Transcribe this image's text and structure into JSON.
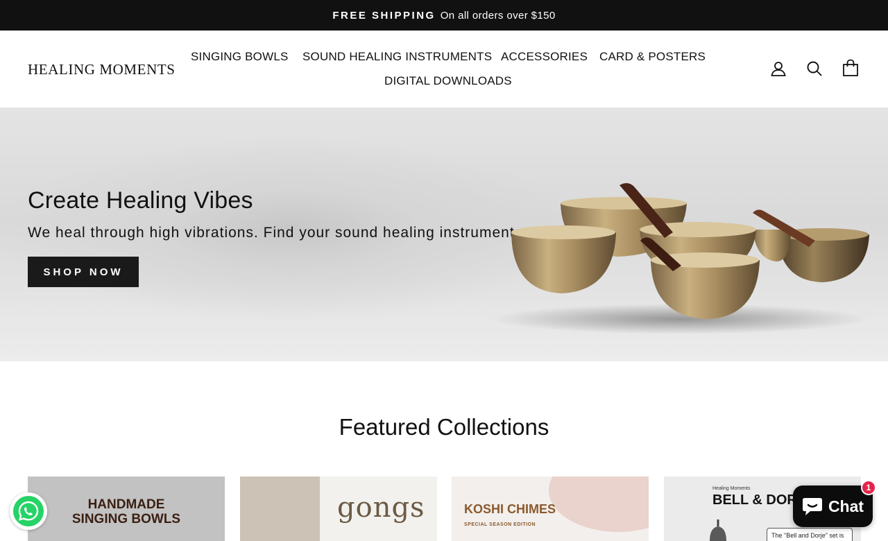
{
  "announcement": {
    "strong": "FREE SHIPPING",
    "text": "On all orders over $150"
  },
  "header": {
    "logo": "HEALING MOMENTS",
    "nav": [
      {
        "label": "SINGING BOWLS"
      },
      {
        "label": "SOUND HEALING INSTRUMENTS"
      },
      {
        "label": "ACCESSORIES"
      },
      {
        "label": "CARD & POSTERS"
      },
      {
        "label": "DIGITAL DOWNLOADS"
      }
    ],
    "icons": [
      "account-icon",
      "search-icon",
      "cart-icon"
    ]
  },
  "hero": {
    "title": "Create Healing Vibes",
    "subtitle": "We heal through high vibrations. Find your sound healing instrument.",
    "cta": "SHOP NOW"
  },
  "featured": {
    "title": "Featured Collections",
    "collections": [
      {
        "line1": "HANDMADE",
        "line2": "SINGING BOWLS"
      },
      {
        "title": "gongs"
      },
      {
        "title": "KOSHI CHIMES",
        "subtitle": "SPECIAL SEASON EDITION"
      },
      {
        "small": "Healing Moments",
        "title": "BELL & DOR",
        "note": "The \"Bell and Dorje\" set is"
      }
    ]
  },
  "chat": {
    "label": "Chat",
    "badge": "1"
  },
  "colors": {
    "announcement_bg": "#111111",
    "cta_bg": "#1a1a1a",
    "chat_badge": "#e5244a",
    "whatsapp": "#25d366"
  }
}
